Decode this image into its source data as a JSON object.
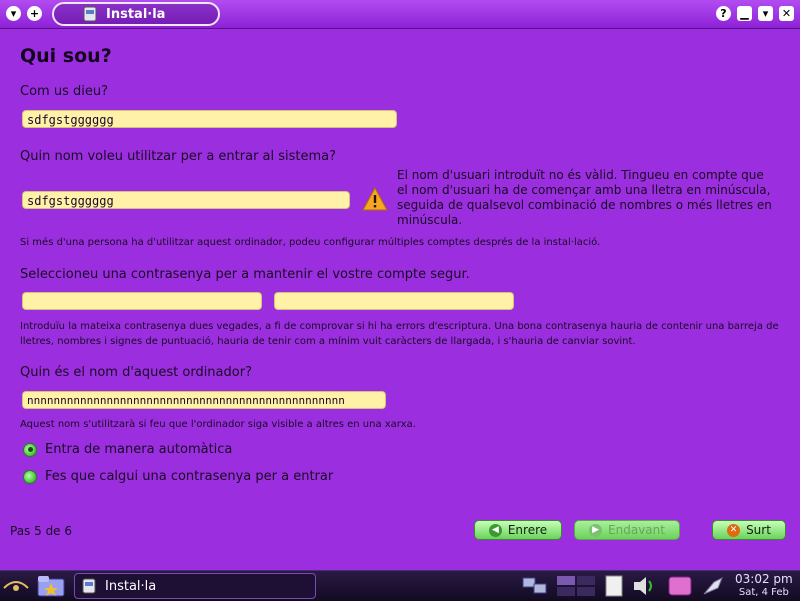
{
  "window": {
    "title": "Instal·la",
    "buttons": [
      "help-icon",
      "minimize-icon",
      "shade-icon",
      "close-icon"
    ]
  },
  "page": {
    "heading": "Qui sou?",
    "name_label": "Com us dieu?",
    "name_value": "sdfgstgggggg",
    "username_label": "Quin nom voleu utilitzar per a entrar al sistema?",
    "username_value": "sdfgstgggggg",
    "username_warning": "El nom d'usuari introduït no és vàlid. Tingueu en compte que el nom d'usuari ha de començar amb una lletra en minúscula, seguida de qualsevol combinació de nombres o més lletres en minúscula.",
    "multi_user_hint": "Si més d'una persona ha d'utilitzar aquest ordinador, podeu configurar múltiples comptes després de la instal·lació.",
    "password_label": "Seleccioneu una contrasenya per a mantenir el vostre compte segur.",
    "password_value": "",
    "password_confirm_value": "",
    "password_hint": "Introduïu la mateixa contrasenya dues vegades, a fi de comprovar si hi ha errors d'escriptura. Una bona contrasenya hauria de contenir una barreja de lletres, nombres i signes de puntuació, hauria de tenir com a mínim vuit caràcters de llargada, i s'hauria de canviar sovint.",
    "hostname_label": "Quin és el nom d'aquest ordinador?",
    "hostname_value": "nnnnnnnnnnnnnnnnnnnnnnnnnnnnnnnnnnnnnnnnnnnnnnnn",
    "hostname_hint": "Aquest nom s'utilitzarà si feu que l'ordinador siga visible a altres en una xarxa.",
    "radio_auto_login": "Entra de manera automàtica",
    "radio_require_password": "Fes que calgui una contrasenya per a entrar",
    "selected_radio": "auto_login"
  },
  "footer": {
    "step": "Pas 5 de 6",
    "back": "Enrere",
    "forward": "Endavant",
    "quit": "Surt"
  },
  "taskbar": {
    "task_label": "Instal·la",
    "time": "03:02 pm",
    "date": "Sat, 4 Feb"
  },
  "colors": {
    "background": "#9b2fe0",
    "field": "#fff1a8",
    "button": "#6bd25a"
  }
}
